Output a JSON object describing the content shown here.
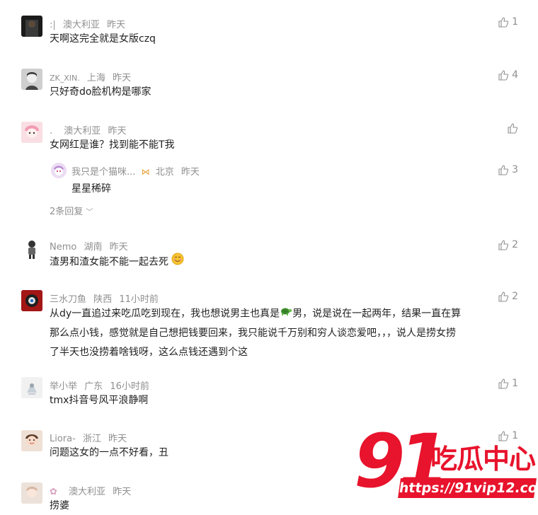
{
  "comments": [
    {
      "user": "",
      "location": "澳大利亚",
      "time": "昨天",
      "text": "天啊这完全就是女版czq",
      "likes": "1"
    },
    {
      "user": "ZK_XIN.",
      "location": "上海",
      "time": "昨天",
      "text": "只好奇do脸机构是哪家",
      "likes": "4"
    },
    {
      "user": ".",
      "location": "澳大利亚",
      "time": "昨天",
      "text": "女网红是谁？找到能不能T我",
      "likes": "",
      "reply": {
        "user": "我只是个猫咪...",
        "location": "北京",
        "time": "昨天",
        "text": "星星稀碎",
        "likes": "3"
      },
      "more_replies": "2条回复"
    },
    {
      "user": "Nemo",
      "location": "湖南",
      "time": "昨天",
      "text": "渣男和渣女能不能一起去死",
      "likes": "2"
    },
    {
      "user": "三水刀鱼",
      "location": "陕西",
      "time": "11小时前",
      "text_part1": "从dy一直追过来吃瓜吃到现在，我也想说男主也真是",
      "text_part2": "男，说是说在一起两年，结果一直在算",
      "line2": "那么点小钱，感觉就是自己想把钱要回来，我只能说千万别和穷人谈恋爱吧，，，说人是捞女捞",
      "line3": "了半天也没捞着啥钱呀，这么点钱还遇到个这",
      "likes": "2"
    },
    {
      "user": "举小举",
      "location": "广东",
      "time": "16小时前",
      "text": "tmx抖音号风平浪静啊",
      "likes": "1"
    },
    {
      "user": "Liora-",
      "location": "浙江",
      "time": "昨天",
      "text": "问题这女的一点不好看，丑",
      "likes": "1"
    },
    {
      "user": "",
      "location": "澳大利亚",
      "time": "昨天",
      "text": "捞婆",
      "likes": ""
    }
  ],
  "watermark": {
    "number": "91",
    "title": "吃瓜中心",
    "url": "https://91vip12.com"
  },
  "colors": {
    "accent": "#e8132c",
    "meta": "#8f8f8f",
    "text": "#1f1f1f"
  }
}
